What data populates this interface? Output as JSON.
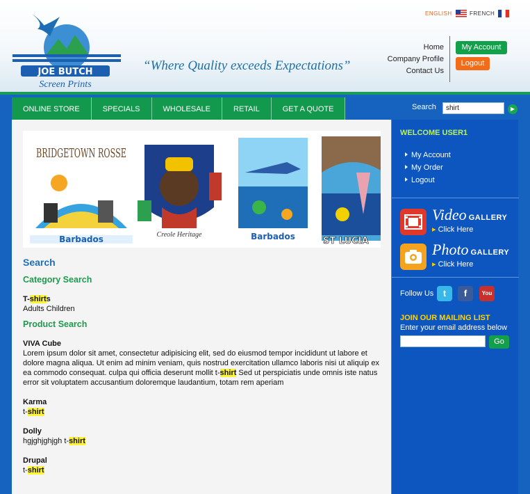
{
  "header": {
    "logo_text": "JOE BUTCH",
    "logo_subtext": "Screen Prints",
    "tagline": "“Where Quality exceeds Expectations”",
    "languages": [
      {
        "label": "ENGLISH",
        "active": true
      },
      {
        "label": "FRENCH",
        "active": false
      }
    ],
    "links": [
      "Home",
      "Company Profile",
      "Contact Us"
    ],
    "my_account_label": "My Account",
    "logout_label": "Logout"
  },
  "nav": {
    "items": [
      "ONLINE STORE",
      "SPECIALS",
      "WHOLESALE",
      "RETAIL",
      "GET A QUOTE"
    ],
    "search_label": "Search",
    "search_value": "shirt"
  },
  "banner": {
    "images": [
      {
        "caption": "Barbados",
        "title": "BRIDGETOWN ROSSE"
      },
      {
        "caption": "Creole Heritage",
        "title": ""
      },
      {
        "caption": "Barbados",
        "title": ""
      },
      {
        "caption": "ST LUCIA",
        "title": ""
      }
    ]
  },
  "results": {
    "heading": "Search",
    "category_heading": "Category Search",
    "categories": [
      {
        "pre": "T-",
        "match": "shirt",
        "post": "s",
        "sub": "Adults Children"
      }
    ],
    "product_heading": "Product Search",
    "products": [
      {
        "name": "VIVA Cube",
        "desc_pre": "Lorem ipsum dolor sit amet, consectetur adipisicing elit, sed do eiusmod tempor incididunt ut labore et dolore magna aliqua. Ut enim ad minim veniam, quis nostrud exercitation ullamco laboris nisi ut aliquip ex ea commodo consequat. culpa qui officia deserunt mollit t-",
        "match": "shirt",
        "desc_post": " Sed ut perspiciatis unde omnis iste natus error sit voluptatem accusantium doloremque laudantium, totam rem aperiam"
      },
      {
        "name": "Karma",
        "desc_pre": "t-",
        "match": "shirt",
        "desc_post": ""
      },
      {
        "name": "Dolly",
        "desc_pre": "hgjghjghjgh t-",
        "match": "shirt",
        "desc_post": ""
      },
      {
        "name": "Drupal",
        "desc_pre": "t-",
        "match": "shirt",
        "desc_post": ""
      }
    ]
  },
  "sidebar": {
    "welcome": "WELCOME USER1",
    "links": [
      "My Account",
      "My Order",
      "Logout"
    ],
    "video": {
      "big": "Video",
      "small": "GALLERY",
      "click": "Click Here"
    },
    "photo": {
      "big": "Photo",
      "small": "GALLERY",
      "click": "Click Here"
    },
    "follow_label": "Follow Us",
    "social": [
      "twitter-icon",
      "facebook-icon",
      "youtube-icon"
    ],
    "mailing_heading": "JOIN OUR MAILING LIST",
    "mailing_text": "Enter your email address below",
    "mailing_go": "Go"
  },
  "colors": {
    "nav_green": "#13994d",
    "blue": "#0e56bf",
    "orange": "#f26c1a",
    "highlight": "#fff335"
  }
}
